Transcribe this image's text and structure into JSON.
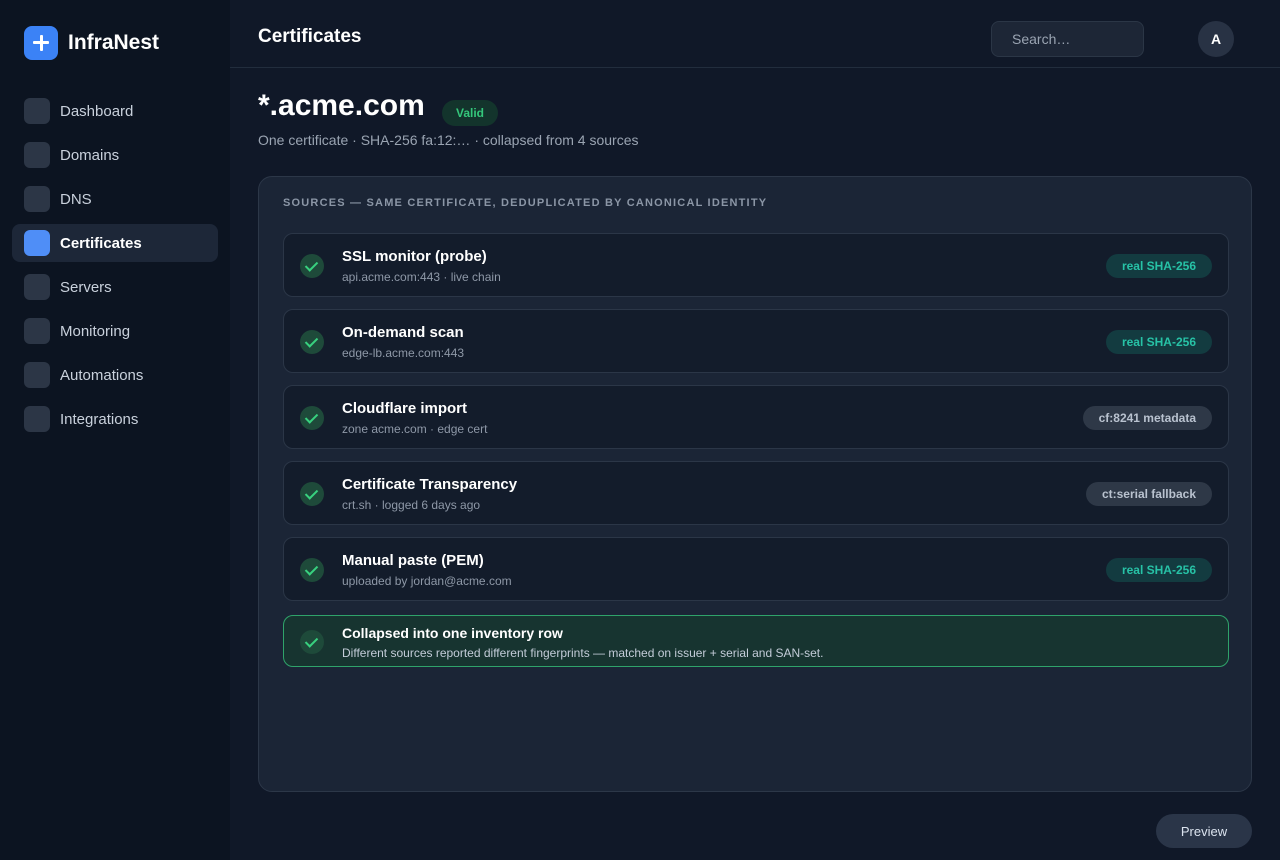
{
  "app": {
    "name": "InfraNest",
    "logo_icon": "plus-icon",
    "accent": "#3b82f6"
  },
  "sidebar": {
    "items": [
      {
        "label": "Dashboard",
        "active": false
      },
      {
        "label": "Domains",
        "active": false
      },
      {
        "label": "DNS",
        "active": false
      },
      {
        "label": "Certificates",
        "active": true
      },
      {
        "label": "Servers",
        "active": false
      },
      {
        "label": "Monitoring",
        "active": false
      },
      {
        "label": "Automations",
        "active": false
      },
      {
        "label": "Integrations",
        "active": false
      }
    ]
  },
  "header": {
    "title": "Certificates",
    "search_placeholder": "Search…",
    "avatar_initial": "A"
  },
  "certificate": {
    "name": "*.acme.com",
    "status": "Valid",
    "status_color": "#34c77b",
    "subtitle": "One certificate · SHA-256 fa:12:… · collapsed from 4 sources"
  },
  "sources": {
    "heading": "SOURCES — SAME CERTIFICATE, DEDUPLICATED BY CANONICAL IDENTITY",
    "items": [
      {
        "name": "SSL monitor (probe)",
        "detail": "api.acme.com:443 · live chain",
        "badge": "real SHA-256",
        "badge_kind": "sha"
      },
      {
        "name": "On-demand scan",
        "detail": "edge-lb.acme.com:443",
        "badge": "real SHA-256",
        "badge_kind": "sha"
      },
      {
        "name": "Cloudflare import",
        "detail": "zone acme.com · edge cert",
        "badge": "cf:8241 metadata",
        "badge_kind": "meta"
      },
      {
        "name": "Certificate Transparency",
        "detail": "crt.sh · logged 6 days ago",
        "badge": "ct:serial fallback",
        "badge_kind": "meta"
      },
      {
        "name": "Manual paste (PEM)",
        "detail": "uploaded by jordan@acme.com",
        "badge": "real SHA-256",
        "badge_kind": "sha"
      }
    ]
  },
  "summary": {
    "title": "Collapsed into one inventory row",
    "detail": "Different sources reported different fingerprints — matched on issuer + serial and SAN-set."
  },
  "footer": {
    "preview_label": "Preview"
  }
}
